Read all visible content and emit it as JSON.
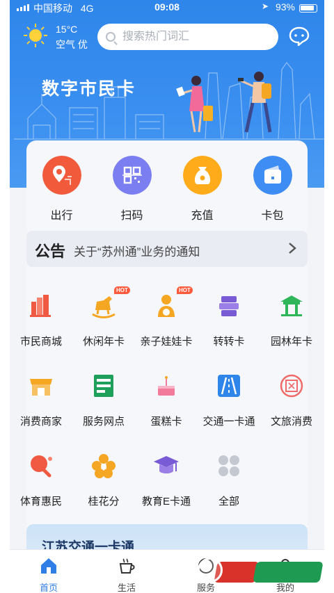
{
  "status_bar": {
    "carrier": "中国移动",
    "network": "4G",
    "time": "09:08",
    "battery": "93%"
  },
  "header": {
    "weather": {
      "temperature": "15°C",
      "air_quality": "空气 优"
    },
    "search": {
      "placeholder": "搜索热门词汇"
    }
  },
  "hero": {
    "title": "数字市民卡"
  },
  "quick_actions": [
    {
      "label": "出行",
      "icon": "location-pin-icon",
      "color": "#f25a3c"
    },
    {
      "label": "扫码",
      "icon": "qr-code-icon",
      "color": "#7b7ef0"
    },
    {
      "label": "充值",
      "icon": "money-bag-icon",
      "color": "#ffab1a"
    },
    {
      "label": "卡包",
      "icon": "wallet-icon",
      "color": "#3d8df5"
    }
  ],
  "notice": {
    "tag": "公告",
    "text": "关于“苏州通”业务的通知"
  },
  "services": [
    {
      "label": "市民商城",
      "icon": "mall-icon",
      "color": "#f15a42",
      "hot": ""
    },
    {
      "label": "休闲年卡",
      "icon": "rocking-horse-icon",
      "color": "#f5a623",
      "hot": "HOT"
    },
    {
      "label": "亲子娃娃卡",
      "icon": "child-icon",
      "color": "#f5a623",
      "hot": "HOT"
    },
    {
      "label": "转转卡",
      "icon": "transfer-icon",
      "color": "#7a5bd6",
      "hot": ""
    },
    {
      "label": "园林年卡",
      "icon": "pavilion-icon",
      "color": "#2fb65a",
      "hot": ""
    },
    {
      "label": "消费商家",
      "icon": "shop-icon",
      "color": "#f5a623",
      "hot": ""
    },
    {
      "label": "服务网点",
      "icon": "service-point-icon",
      "color": "#1fa05a",
      "hot": ""
    },
    {
      "label": "蛋糕卡",
      "icon": "cake-icon",
      "color": "#f27a9a",
      "hot": ""
    },
    {
      "label": "交通一卡通",
      "icon": "road-icon",
      "color": "#2f86ea",
      "hot": ""
    },
    {
      "label": "文旅消费",
      "icon": "seal-icon",
      "color": "#f06a6a",
      "hot": ""
    },
    {
      "label": "体育惠民",
      "icon": "ping-pong-icon",
      "color": "#f15a42",
      "hot": ""
    },
    {
      "label": "桂花分",
      "icon": "osmanthus-icon",
      "color": "#f5a623",
      "hot": ""
    },
    {
      "label": "教育E卡通",
      "icon": "graduation-cap-icon",
      "color": "#7a5bd6",
      "hot": ""
    },
    {
      "label": "全部",
      "icon": "all-grid-icon",
      "color": "#c4c8d0",
      "hot": ""
    }
  ],
  "bottom_card": {
    "title": "江苏交通一卡通"
  },
  "tabbar": [
    {
      "label": "首页",
      "icon": "home-icon",
      "active": true
    },
    {
      "label": "生活",
      "icon": "coffee-icon",
      "active": false
    },
    {
      "label": "服务",
      "icon": "service-icon",
      "active": false
    },
    {
      "label": "我的",
      "icon": "profile-icon",
      "active": false
    }
  ]
}
